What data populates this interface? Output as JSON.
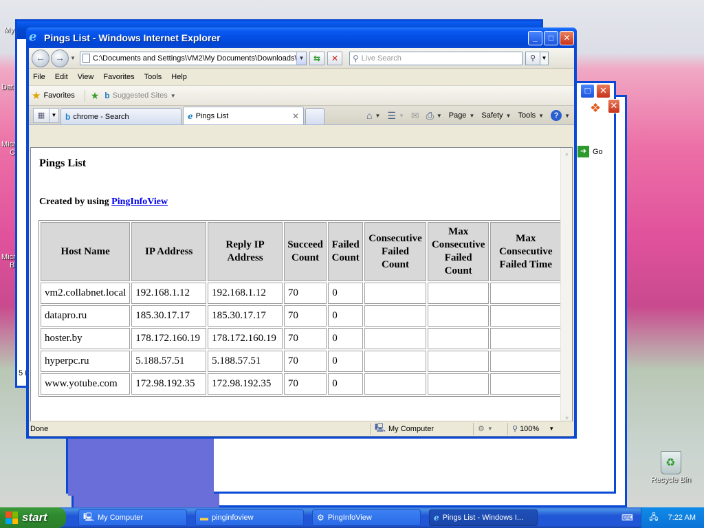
{
  "desktop": {
    "recycle_bin_label": "Recycle Bin",
    "left_fragments": [
      "My",
      "Dat",
      "Micro",
      "C",
      "Micro",
      "B",
      "5 i"
    ]
  },
  "ie": {
    "title": "Pings List - Windows Internet Explorer",
    "address": "C:\\Documents and Settings\\VM2\\My Documents\\Downloads\\pingi",
    "search_placeholder": "Live Search",
    "menu": [
      "File",
      "Edit",
      "View",
      "Favorites",
      "Tools",
      "Help"
    ],
    "favorites_label": "Favorites",
    "suggested_sites_label": "Suggested Sites",
    "tabs": [
      {
        "label": "chrome - Search",
        "active": false
      },
      {
        "label": "Pings List",
        "active": true
      }
    ],
    "command_bar": {
      "page": "Page",
      "safety": "Safety",
      "tools": "Tools"
    },
    "status": {
      "text": "Done",
      "zone": "My Computer",
      "zoom": "100%"
    }
  },
  "page": {
    "title": "Pings List",
    "created_prefix": "Created by using ",
    "created_link": "PingInfoView",
    "columns": [
      "Host Name",
      "IP Address",
      "Reply IP Address",
      "Succeed Count",
      "Failed Count",
      "Consecutive Failed Count",
      "Max Consecutive Failed Count",
      "Max Consecutive Failed Time"
    ],
    "rows": [
      [
        "vm2.collabnet.local",
        "192.168.1.12",
        "192.168.1.12",
        "70",
        "0",
        "",
        "",
        ""
      ],
      [
        "datapro.ru",
        "185.30.17.17",
        "185.30.17.17",
        "70",
        "0",
        "",
        "",
        ""
      ],
      [
        "hoster.by",
        "178.172.160.19",
        "178.172.160.19",
        "70",
        "0",
        "",
        "",
        ""
      ],
      [
        "hyperpc.ru",
        "5.188.57.51",
        "5.188.57.51",
        "70",
        "0",
        "",
        "",
        ""
      ],
      [
        "www.yotube.com",
        "172.98.192.35",
        "172.98.192.35",
        "70",
        "0",
        "",
        "",
        ""
      ]
    ]
  },
  "background_windows": {
    "go_label": "Go"
  },
  "taskbar": {
    "start_label": "start",
    "buttons": [
      {
        "label": "My Computer",
        "icon": "computer-icon",
        "active": false
      },
      {
        "label": "pinginfoview",
        "icon": "folder-icon",
        "active": false
      },
      {
        "label": "PingInfoView",
        "icon": "app-icon",
        "active": false
      },
      {
        "label": "Pings List - Windows I...",
        "icon": "ie-icon",
        "active": true
      }
    ],
    "clock": "7:22 AM"
  }
}
